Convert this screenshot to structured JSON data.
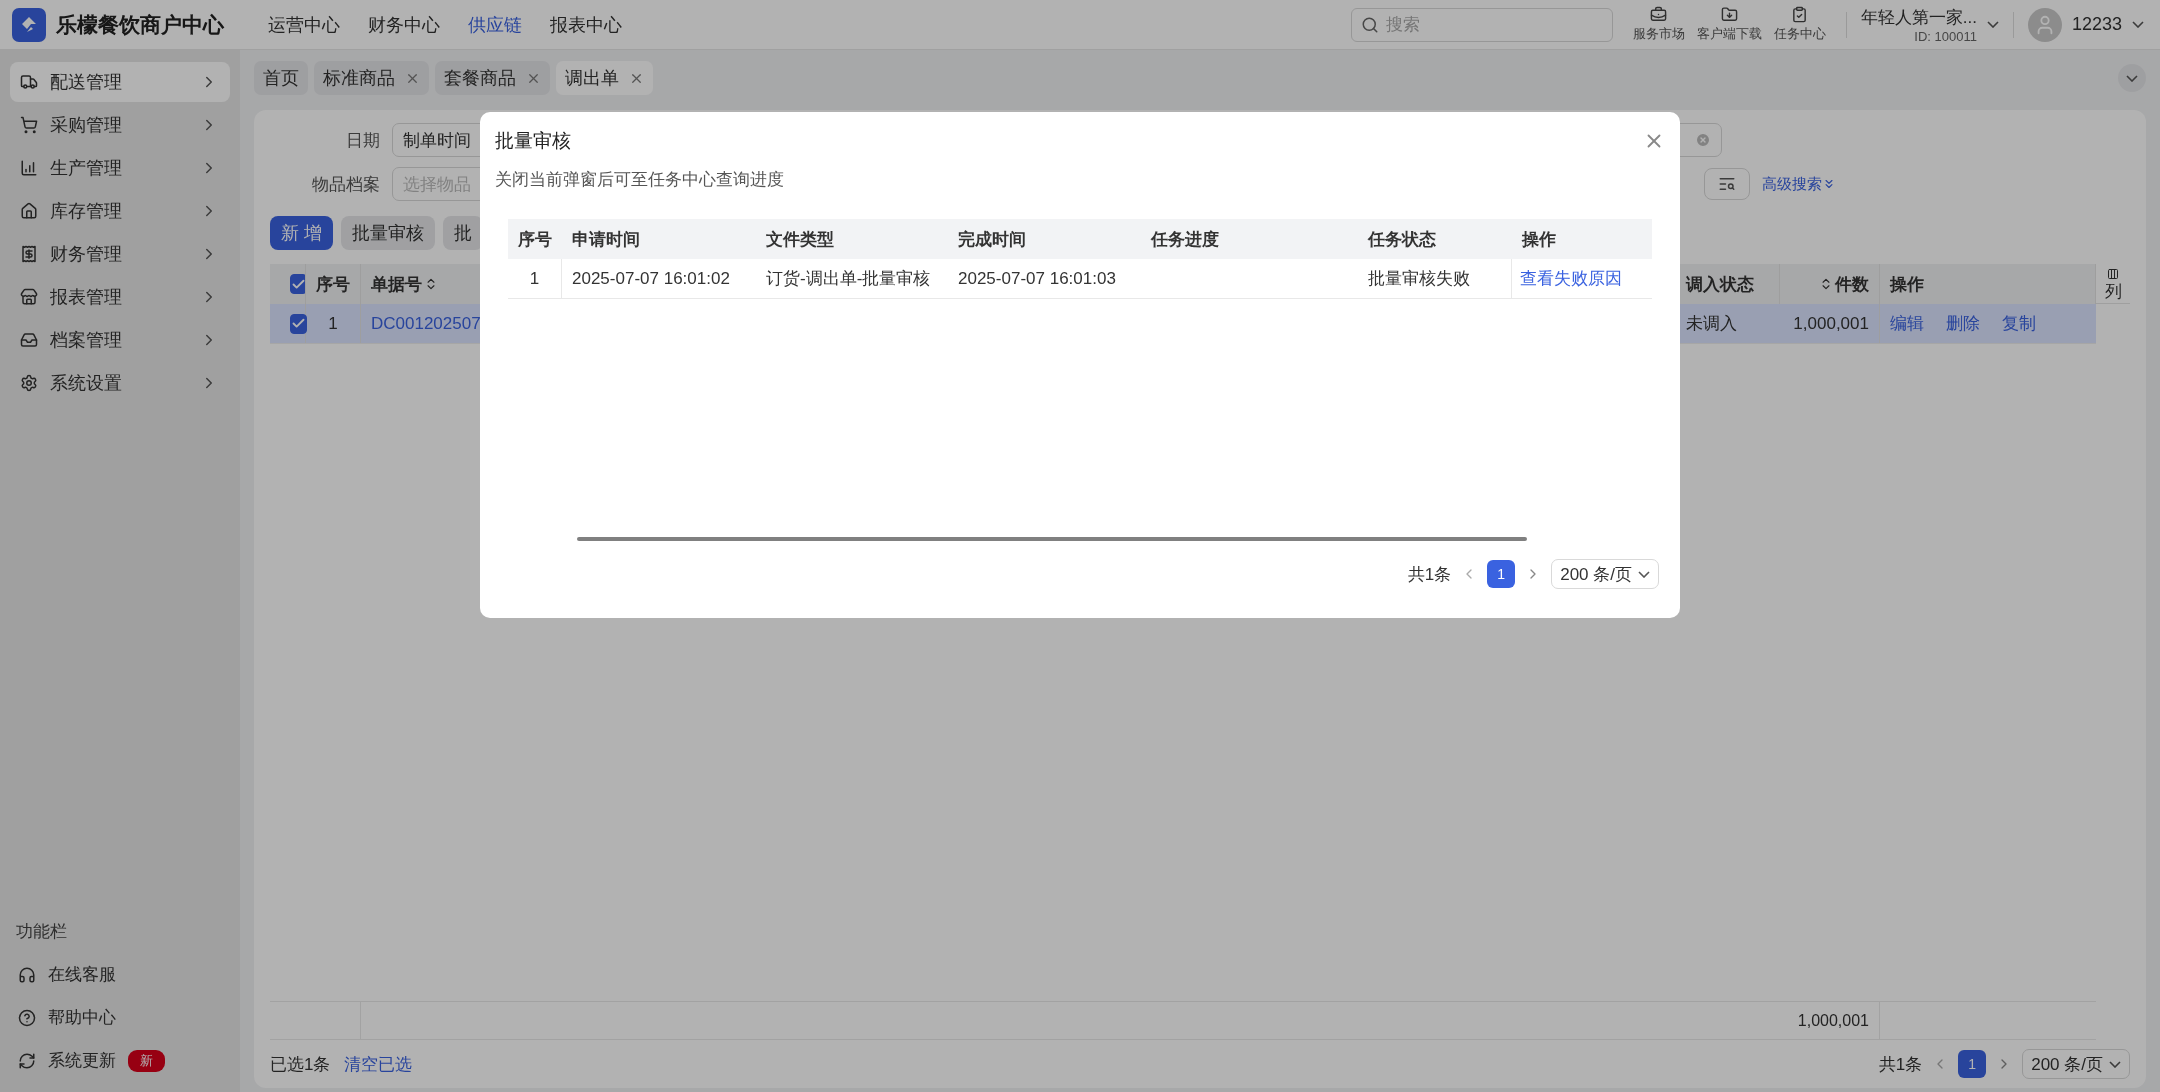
{
  "brand": {
    "name": "乐檬餐饮商户中心"
  },
  "top_nav": [
    {
      "label": "运营中心",
      "selected": false
    },
    {
      "label": "财务中心",
      "selected": false
    },
    {
      "label": "供应链",
      "selected": true
    },
    {
      "label": "报表中心",
      "selected": false
    }
  ],
  "search": {
    "placeholder": "搜索"
  },
  "top_tools": [
    {
      "kind": "market",
      "label": "服务市场"
    },
    {
      "kind": "download",
      "label": "客户端下载"
    },
    {
      "kind": "tasks",
      "label": "任务中心"
    }
  ],
  "account": {
    "store": "年轻人第一家...",
    "id": "ID: 100011",
    "user": "12233"
  },
  "sidebar": {
    "items": [
      {
        "kind": "delivery",
        "label": "配送管理",
        "selected": true
      },
      {
        "kind": "purchase",
        "label": "采购管理",
        "selected": false
      },
      {
        "kind": "production",
        "label": "生产管理",
        "selected": false
      },
      {
        "kind": "stock",
        "label": "库存管理",
        "selected": false
      },
      {
        "kind": "finance",
        "label": "财务管理",
        "selected": false
      },
      {
        "kind": "report",
        "label": "报表管理",
        "selected": false
      },
      {
        "kind": "archive",
        "label": "档案管理",
        "selected": false
      },
      {
        "kind": "settings",
        "label": "系统设置",
        "selected": false
      }
    ],
    "footer_title": "功能栏",
    "footer_items": [
      {
        "kind": "service",
        "label": "在线客服"
      },
      {
        "kind": "help",
        "label": "帮助中心"
      },
      {
        "kind": "update",
        "label": "系统更新",
        "badge": "新"
      }
    ]
  },
  "tabs": [
    {
      "label": "首页",
      "closable": false,
      "selected": false
    },
    {
      "label": "标准商品",
      "closable": true,
      "selected": false
    },
    {
      "label": "套餐商品",
      "closable": true,
      "selected": false
    },
    {
      "label": "调出单",
      "closable": true,
      "selected": true
    }
  ],
  "filters": {
    "date_label": "日期",
    "date_type": "制单时间",
    "item_label": "物品档案",
    "item_placeholder": "选择物品",
    "advanced": "高级搜索"
  },
  "actions": [
    {
      "label": "新 增",
      "primary": true
    },
    {
      "label": "批量审核",
      "primary": false
    },
    {
      "label": "批",
      "primary": false
    }
  ],
  "table": {
    "all_checked": true,
    "columns": [
      {
        "label": "序号",
        "sortable": false
      },
      {
        "label": "单据号",
        "sortable": true
      },
      {
        "label": "调入状态",
        "sortable": false
      },
      {
        "label": "件数",
        "sortable": true
      },
      {
        "label": "操作",
        "sortable": false
      }
    ],
    "column_settings": "列",
    "rows": [
      {
        "selected": true,
        "checked": true,
        "index": "1",
        "number": "DC001202507",
        "status": "未调入",
        "count": "1,000,001",
        "operations": [
          "编辑",
          "删除",
          "复制"
        ]
      }
    ],
    "total_count": "1,000,001"
  },
  "footer": {
    "selected_text": "已选1条",
    "clear": "清空已选",
    "total": "共1条",
    "pages": [
      {
        "label": "1",
        "selected": true
      }
    ],
    "page_size": "200 条/页"
  },
  "dialog": {
    "title": "批量审核",
    "subtitle": "关闭当前弹窗后可至任务中心查询进度",
    "columns": [
      "序号",
      "申请时间",
      "文件类型",
      "完成时间",
      "任务进度",
      "任务状态",
      "操作"
    ],
    "rows": [
      {
        "index": "1",
        "requested": "2025-07-07 16:01:02",
        "file_type": "订货-调出单-批量审核",
        "finished": "2025-07-07 16:01:03",
        "progress": "",
        "status": "批量审核失败",
        "action": "查看失败原因"
      }
    ],
    "total": "共1条",
    "pages": [
      {
        "label": "1",
        "selected": true
      }
    ],
    "page_size": "200 条/页"
  }
}
